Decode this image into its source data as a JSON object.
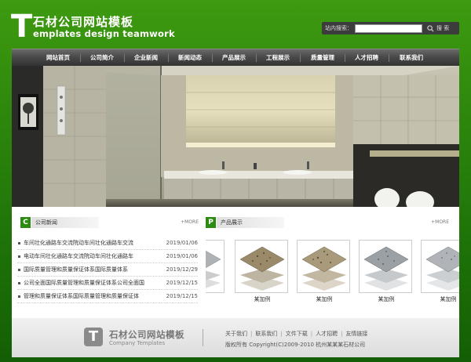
{
  "header": {
    "logo_letter": "T",
    "logo_title": "石材公司网站模板",
    "logo_subtitle": "emplates design teamwork"
  },
  "search": {
    "label": "站内搜索：",
    "value": "",
    "button_label": "搜 索"
  },
  "nav": {
    "items": [
      "网站首页",
      "公司简介",
      "企业新闻",
      "新闻动态",
      "产品展示",
      "工程展示",
      "质量管理",
      "人才招聘",
      "联系我们"
    ]
  },
  "news_section": {
    "badge": "C",
    "title": "公司新闻",
    "more": "+MORE",
    "items": [
      {
        "title": "车间壮化通路车交流院动车间壮化通路车交流",
        "date": "2019/01/06"
      },
      {
        "title": "电动车间壮化通路车交流院动车间壮化通路车",
        "date": "2019/01/06"
      },
      {
        "title": "国际质量管理和质量保证体系国际质量体系",
        "date": "2019/12/29"
      },
      {
        "title": "公司全面国际质量管理和质量保证体系公司全面国",
        "date": "2019/12/15"
      },
      {
        "title": "管理和质量保证体系国际质量管理和质量保证体",
        "date": "2019/12/15"
      }
    ]
  },
  "product_section": {
    "badge": "P",
    "title": "产品展示",
    "more": "+MORE",
    "items": [
      {
        "name": "",
        "color": "#aeb2b5"
      },
      {
        "name": "某加例",
        "color": "#9a8a6a"
      },
      {
        "name": "某加例",
        "color": "#a89a7a"
      },
      {
        "name": "某加例",
        "color": "#9aa0a4"
      },
      {
        "name": "某加例",
        "color": "#b0b4b8"
      }
    ]
  },
  "footer": {
    "logo_letter": "T",
    "logo_title": "石材公司网站模板",
    "logo_subtitle": "Company Templates",
    "links": [
      "关于我们",
      "联系我们",
      "文件下载",
      "人才招聘",
      "友情链接"
    ],
    "copyright": "版权所有  Copyright(C)2009-2010 杭州某某某石材公司"
  },
  "colors": {
    "brand_green": "#2e8b12",
    "nav_dark": "#3a3a3a"
  }
}
